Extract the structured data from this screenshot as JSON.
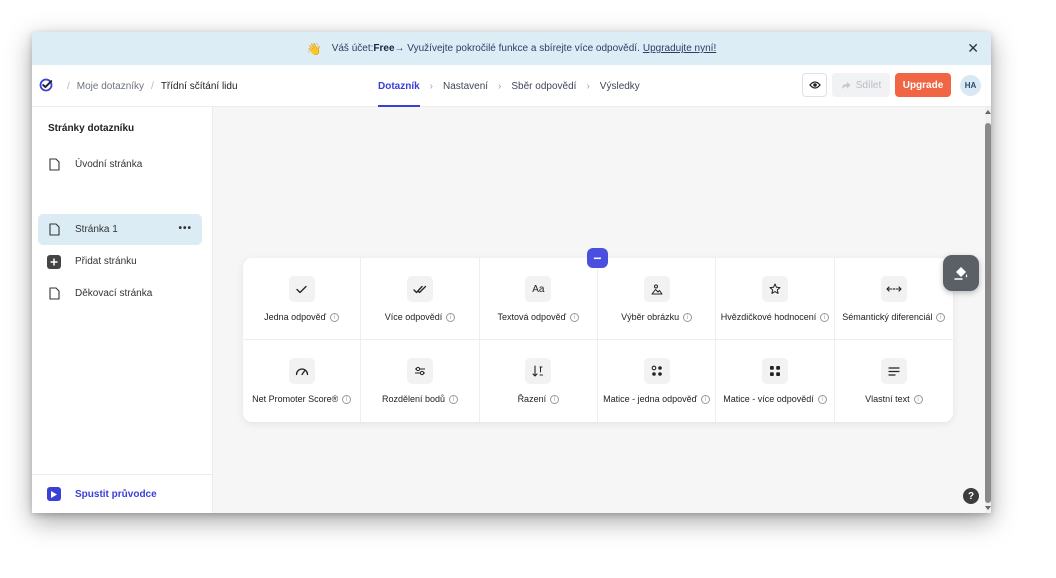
{
  "banner": {
    "emoji": "👋",
    "prefix": "Váš účet: ",
    "plan": "Free",
    "message": " → Využívejte pokročilé funkce a sbírejte více odpovědí.",
    "link": "Upgradujte nyní!",
    "close": "✕"
  },
  "breadcrumb": {
    "parent": "Moje dotazníky",
    "current": "Třídní sčítání lidu"
  },
  "steps": [
    "Dotazník",
    "Nastavení",
    "Sběr odpovědí",
    "Výsledky"
  ],
  "toolbar": {
    "share_label": "Sdílet",
    "upgrade_label": "Upgrade",
    "avatar_initials": "HA"
  },
  "sidebar": {
    "title": "Stránky dotazníku",
    "items": [
      {
        "label": "Úvodní stránka",
        "icon": "page-icon"
      },
      {
        "label": "Stránka 1",
        "icon": "page-icon",
        "selected": true
      },
      {
        "label": "Přidat stránku",
        "icon": "plus-icon"
      },
      {
        "label": "Děkovací stránka",
        "icon": "page-icon"
      }
    ],
    "more": "•••",
    "footer_label": "Spustit průvodce"
  },
  "question_types": [
    {
      "label": "Jedna odpověď",
      "icon": "check-icon"
    },
    {
      "label": "Více odpovědí",
      "icon": "double-check-icon"
    },
    {
      "label": "Textová odpověď",
      "icon": "text-icon",
      "glyph": "Aa"
    },
    {
      "label": "Výběr obrázku",
      "icon": "image-icon"
    },
    {
      "label": "Hvězdičkové hodnocení",
      "icon": "star-icon"
    },
    {
      "label": "Sémantický diferenciál",
      "icon": "arrows-icon"
    },
    {
      "label": "Net Promoter Score®",
      "icon": "gauge-icon"
    },
    {
      "label": "Rozdělení bodů",
      "icon": "sliders-icon"
    },
    {
      "label": "Řazení",
      "icon": "sort-icon"
    },
    {
      "label": "Matice - jedna odpověď",
      "icon": "matrix-single-icon"
    },
    {
      "label": "Matice - více odpovědí",
      "icon": "matrix-multi-icon"
    },
    {
      "label": "Vlastní text",
      "icon": "paragraph-icon"
    }
  ],
  "info_glyph": "i",
  "collapse_glyph": "−",
  "help_glyph": "?",
  "colors": {
    "accent": "#3a3fd6",
    "upgrade": "#f06543",
    "banner_bg": "#dcedf6",
    "selected_bg": "#dcecf4"
  }
}
